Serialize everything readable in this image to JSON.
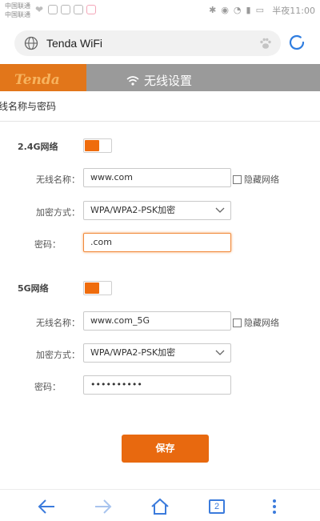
{
  "status_bar": {
    "carrier1": "中国联通",
    "carrier2": "中国联通",
    "time": "半夜11:00"
  },
  "browser": {
    "title": "Tenda WiFi",
    "tabs_count": "2"
  },
  "header": {
    "brand": "Tenda",
    "title": "无线设置"
  },
  "modal": {
    "title": "线名称与密码"
  },
  "band24": {
    "label": "2.4G网络",
    "enabled": true,
    "name_label": "无线名称：",
    "name_value": "www.com",
    "hide_label": "隐藏网络",
    "encryption_label": "加密方式：",
    "encryption_value": "WPA/WPA2-PSK加密",
    "password_label": "密码：",
    "password_value": ".com"
  },
  "band5": {
    "label": "5G网络",
    "enabled": true,
    "name_label": "无线名称：",
    "name_value": "www.com_5G",
    "hide_label": "隐藏网络",
    "encryption_label": "加密方式：",
    "encryption_value": "WPA/WPA2-PSK加密",
    "password_label": "密码：",
    "password_value": "••••••••••"
  },
  "actions": {
    "save_label": "保存"
  },
  "colors": {
    "accent": "#e8690f",
    "link_blue": "#3b7bdc"
  }
}
